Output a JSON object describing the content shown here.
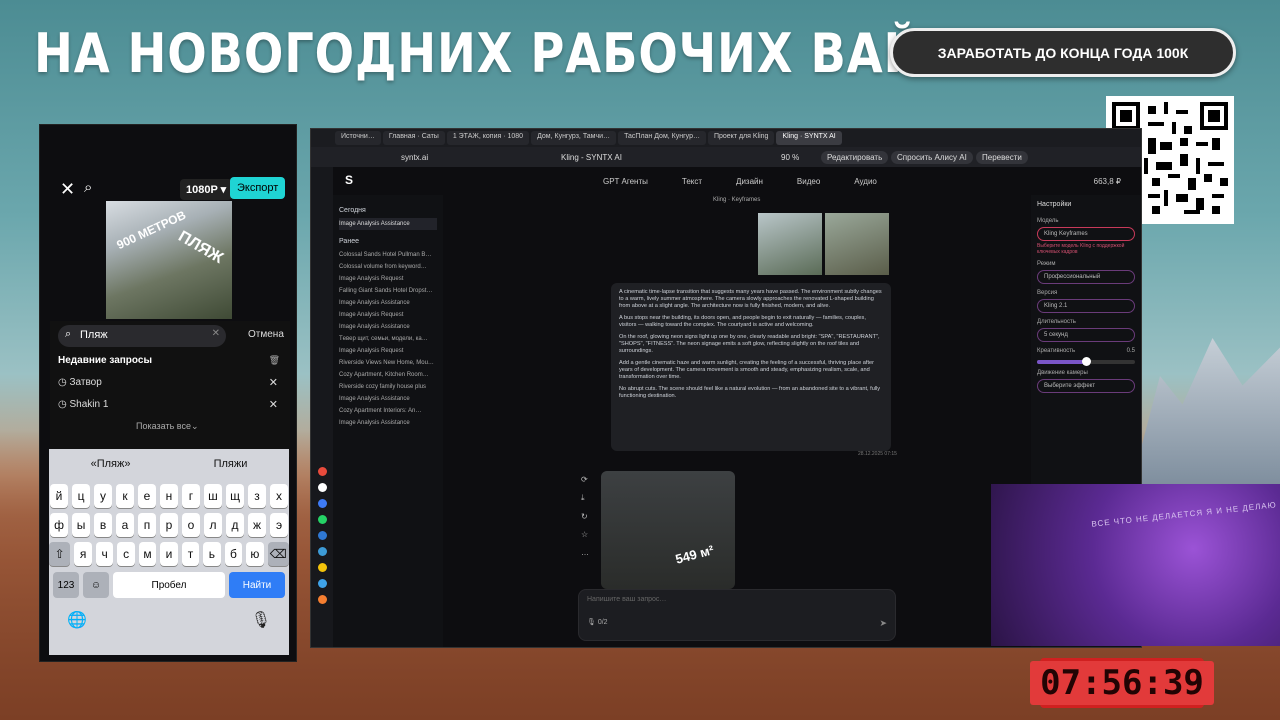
{
  "overlay": {
    "headline": "НА НОВОГОДНИХ РАБОЧИХ ВАЙБАХ",
    "cta": "ЗАРАБОТАТЬ ДО КОНЦА ГОДА 100К",
    "timer": "07:56:39",
    "wall_text": "ВСЕ ЧТО НЕ ДЕЛАЕТСЯ Я И НЕ ДЕЛАЮ"
  },
  "phone": {
    "resolution": "1080P ▾",
    "export": "Экспорт",
    "thumb_label_1": "900 МЕТРОВ",
    "thumb_label_2": "ПЛЯЖ",
    "search_value": "Пляж",
    "cancel": "Отмена",
    "recent_title": "Недавние запросы",
    "recent": [
      "Затвор",
      "Shakin 1"
    ],
    "show_all": "Показать все",
    "suggestions": [
      "«Пляж»",
      "Пляжи"
    ],
    "rows": [
      [
        "й",
        "ц",
        "у",
        "к",
        "е",
        "н",
        "г",
        "ш",
        "щ",
        "з",
        "х"
      ],
      [
        "ф",
        "ы",
        "в",
        "а",
        "п",
        "р",
        "о",
        "л",
        "д",
        "ж",
        "э"
      ],
      [
        "я",
        "ч",
        "с",
        "м",
        "и",
        "т",
        "ь",
        "б",
        "ю"
      ]
    ],
    "key_123": "123",
    "space": "Пробел",
    "go": "Найти"
  },
  "browser": {
    "tabs": [
      "Источни…",
      "Главная · Саты",
      "1 ЭТАЖ, копия · 1080",
      "Дом, Кунгурз, Тамчи…",
      "ТасПлан Дом, Кунгур…",
      "Проект для Kling",
      "Kling · SYNTX AI"
    ],
    "url": "syntx.ai",
    "page_title": "Kling - SYNTX AI",
    "zoom": "90 %",
    "btn_edit": "Редактировать",
    "btn_alice": "Спросить Алису AI",
    "btn_translate": "Перевести"
  },
  "app": {
    "nav": [
      "GPT Агенты",
      "Текст",
      "Дизайн",
      "Видео",
      "Аудио"
    ],
    "balance": "663,8 ₽",
    "crumb": "Kling · Keyframes",
    "today": "Сегодня",
    "today_items": [
      "Image Analysis Assistance"
    ],
    "earlier": "Ранее",
    "history": [
      "Colossal Sands Hotel Pullman B…",
      "Colossal volume from keyword…",
      "Image Analysis Request",
      "Falling Giant Sands Hotel Dropst…",
      "Image Analysis Assistance",
      "Image Analysis Request",
      "Image Analysis Assistance",
      "Tевер щит, семьи, модели, ка…",
      "Image Analysis Request",
      "Riverside Views New Home, Mou…",
      "Cozy Apartment, Kitchen Room…",
      "Riverside cozy family house plus",
      "Image Analysis Assistance",
      "Cozy Apartment Interiors: An…",
      "Image Analysis Assistance"
    ],
    "image_label": "549 м²",
    "message": [
      "A cinematic time-lapse transition that suggests many years have passed. The environment subtly changes to a warm, lively summer atmosphere. The camera slowly approaches the renovated L-shaped building from above at a slight angle. The architecture now is fully finished, modern, and alive.",
      "A bus stops near the building, its doors open, and people begin to exit naturally — families, couples, visitors — walking toward the complex. The courtyard is active and welcoming.",
      "On the roof, glowing neon signs light up one by one, clearly readable and bright: \"SPA\", \"RESTAURANT\", \"SHOPS\", \"FITNESS\". The neon signage emits a soft glow, reflecting slightly on the roof tiles and surroundings.",
      "Add a gentle cinematic haze and warm sunlight, creating the feeling of a successful, thriving place after years of development. The camera movement is smooth and steady, emphasizing realism, scale, and transformation over time.",
      "No abrupt cuts. The scene should feel like a natural evolution — from an abandoned site to a vibrant, fully functioning destination."
    ],
    "message_time": "28.12.2025 07:15",
    "input_placeholder": "Напишите ваш запрос…",
    "counter": "0/2",
    "settings": {
      "title": "Настройки",
      "model_label": "Модель",
      "model": "Kling Keyframes",
      "model_warn": "Выберите модель Kling с поддержкой ключевых кадров",
      "mode_label": "Режим",
      "mode": "Профессиональный",
      "version_label": "Версия",
      "version": "Kling 2.1",
      "duration_label": "Длительность",
      "duration": "5 секунд",
      "creativity_label": "Креативность",
      "creativity": "0.5",
      "creativity_fraction": 0.5,
      "camera_label": "Движение камеры",
      "camera": "Выберите эффект"
    }
  },
  "colors": {
    "accent_cyan": "#1fd4d4",
    "accent_purple": "#7a56c8",
    "timer_red": "#e23a3a"
  }
}
